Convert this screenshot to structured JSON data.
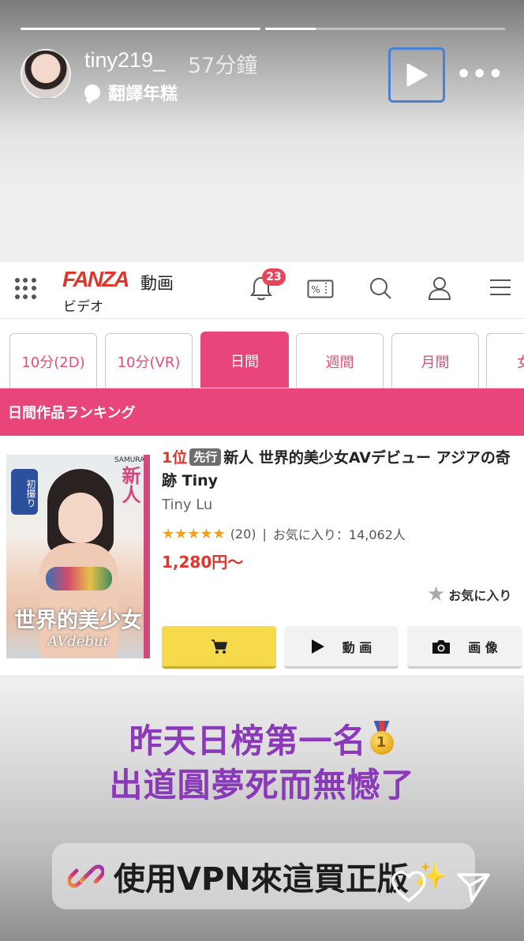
{
  "story": {
    "progress": [
      1.0,
      0.21,
      0.0
    ],
    "username": "tiny219_",
    "time_ago": "57分鐘",
    "translate_label": "翻譯年糕"
  },
  "fanza": {
    "logo": "FANZA",
    "service_label": "動画",
    "subtitle": "ビデオ",
    "notification_count": "23",
    "coupon_icon_text": "%",
    "tabs": [
      {
        "label": "10分(2D)",
        "active": false
      },
      {
        "label": "10分(VR)",
        "active": false
      },
      {
        "label": "日間",
        "active": true
      },
      {
        "label": "週間",
        "active": false
      },
      {
        "label": "月間",
        "active": false
      },
      {
        "label": "女",
        "active": false
      }
    ],
    "ranking_title": "日間作品ランキング",
    "product": {
      "rank": "1位",
      "tag": "先行",
      "title": "新人 世界的美少女AVデビュー アジアの奇跡 Tiny",
      "actress": "Tiny Lu",
      "stars": "★★★★★",
      "rating_value": 4.5,
      "review_count": "(20)",
      "separator": "|",
      "favorites": "お気に入り：14,062人",
      "price": "1,280円〜",
      "favorite_button": "お気に入り",
      "movie_button": "動 画",
      "image_button": "画 像",
      "cover": {
        "badge": "初撮り",
        "side_text": "新人",
        "brand": "SAMURAI",
        "main_text": "世界的美少女",
        "sub_text": "AVdebut"
      }
    }
  },
  "captions": {
    "line1": "昨天日榜第一名",
    "line2": "出道圓夢死而無憾了",
    "medal_number": "1",
    "link_text": "使用VPN來這買正版",
    "sparkle": "✨"
  },
  "colors": {
    "fanza_pink": "#e8457a",
    "fanza_red": "#e0352b",
    "caption_purple": "#8a3ab9",
    "cart_yellow": "#f7d94c",
    "focus_blue": "#4a7fd6"
  }
}
